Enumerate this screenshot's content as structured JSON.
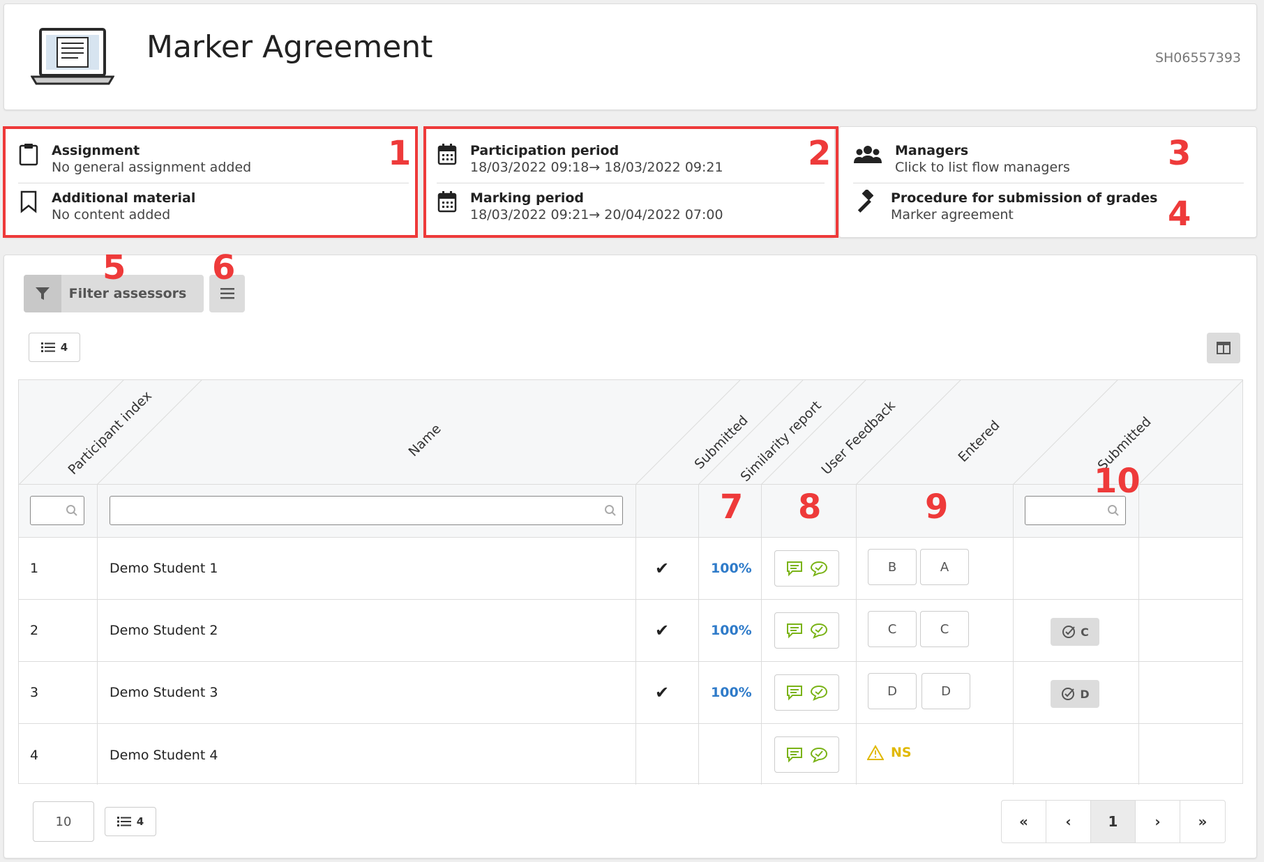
{
  "header": {
    "title": "Marker Agreement",
    "code": "SH06557393"
  },
  "info": {
    "assignment": {
      "title": "Assignment",
      "text": "No general assignment added"
    },
    "material": {
      "title": "Additional material",
      "text": "No content added"
    },
    "participation": {
      "title": "Participation period",
      "text": "18/03/2022 09:18→ 18/03/2022 09:21"
    },
    "marking": {
      "title": "Marking period",
      "text": "18/03/2022 09:21→ 20/04/2022 07:00"
    },
    "managers": {
      "title": "Managers",
      "text": "Click to list flow managers"
    },
    "procedure": {
      "title": "Procedure for submission of grades",
      "text": "Marker agreement"
    }
  },
  "annotations": [
    "1",
    "2",
    "3",
    "4",
    "5",
    "6",
    "7",
    "8",
    "9",
    "10"
  ],
  "toolbar": {
    "filter_label": "Filter assessors",
    "count": "4"
  },
  "table": {
    "headers": {
      "participant_index": "Participant index",
      "name": "Name",
      "submitted": "Submitted",
      "similarity": "Similarity report",
      "feedback": "User Feedback",
      "entered": "Entered",
      "submitted2": "Submitted"
    },
    "rows": [
      {
        "index": "1",
        "name": "Demo Student 1",
        "submitted": "✔",
        "similarity": "100%",
        "grade1": "B",
        "grade2": "A",
        "final": ""
      },
      {
        "index": "2",
        "name": "Demo Student 2",
        "submitted": "✔",
        "similarity": "100%",
        "grade1": "C",
        "grade2": "C",
        "final": "C"
      },
      {
        "index": "3",
        "name": "Demo Student 3",
        "submitted": "✔",
        "similarity": "100%",
        "grade1": "D",
        "grade2": "D",
        "final": "D"
      },
      {
        "index": "4",
        "name": "Demo Student 4",
        "submitted": "",
        "similarity": "",
        "ns": "NS"
      }
    ]
  },
  "footer": {
    "page_size": "10",
    "count": "4",
    "page": "1",
    "first": "«",
    "prev": "‹",
    "next": "›",
    "last": "»"
  },
  "colors": {
    "annotation": "#ee3a3a",
    "link": "#2f7bc9",
    "feedback_icon": "#7ab317",
    "warning": "#e0b800"
  }
}
